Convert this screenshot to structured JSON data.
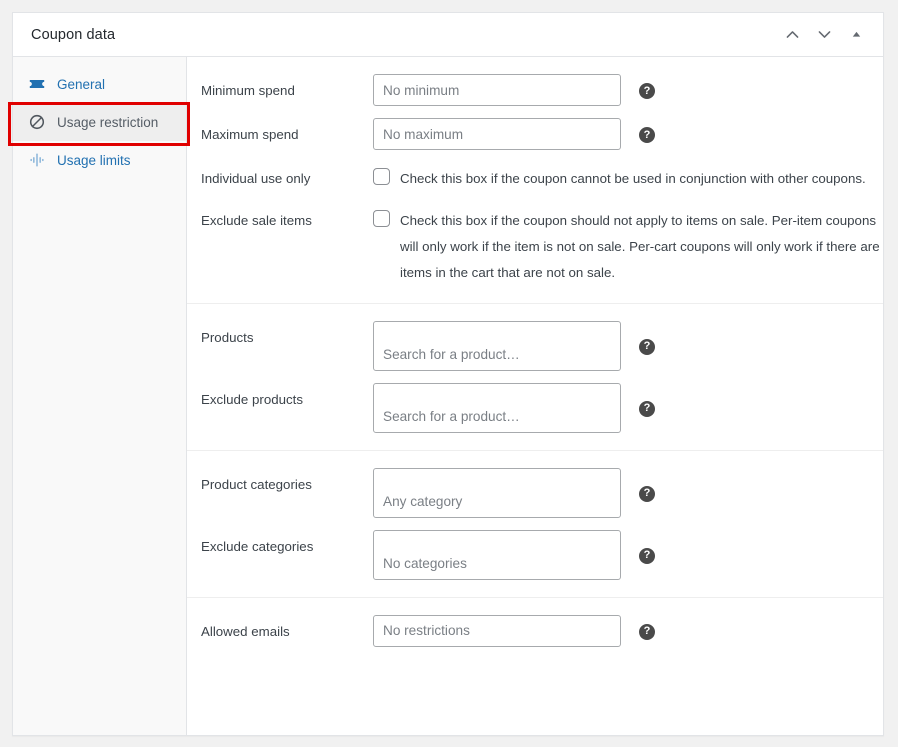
{
  "header": {
    "title": "Coupon data",
    "actions": [
      {
        "name": "move-up-button",
        "icon": "chevron-up-icon",
        "label": "Move up"
      },
      {
        "name": "move-down-button",
        "icon": "chevron-down-icon",
        "label": "Move down"
      },
      {
        "name": "toggle-panel-button",
        "icon": "triangle-up-icon",
        "label": "Toggle panel"
      }
    ]
  },
  "sidebar": {
    "items": [
      {
        "label": "General",
        "icon": "ticket-icon",
        "active": false
      },
      {
        "label": "Usage restriction",
        "icon": "no-entry-icon",
        "active": true
      },
      {
        "label": "Usage limits",
        "icon": "usage-limits-icon",
        "active": false
      }
    ],
    "annotation_color": "#e00000"
  },
  "main": {
    "groups": [
      {
        "rows": [
          {
            "type": "text",
            "label": "Minimum spend",
            "value": "",
            "placeholder": "No minimum",
            "help": "?"
          },
          {
            "type": "text",
            "label": "Maximum spend",
            "value": "",
            "placeholder": "No maximum",
            "help": "?"
          },
          {
            "type": "checkbox",
            "label": "Individual use only",
            "checked": false,
            "text": "Check this box if the coupon cannot be used in conjunction with other coupons."
          },
          {
            "type": "checkbox",
            "label": "Exclude sale items",
            "checked": false,
            "text": "Check this box if the coupon should not apply to items on sale. Per-item coupons will only work if the item is not on sale. Per-cart coupons will only work if there are items in the cart that are not on sale."
          }
        ]
      },
      {
        "rows": [
          {
            "type": "select",
            "label": "Products",
            "placeholder": "Search for a product…",
            "help": "?"
          },
          {
            "type": "select",
            "label": "Exclude products",
            "placeholder": "Search for a product…",
            "help": "?"
          }
        ]
      },
      {
        "rows": [
          {
            "type": "select",
            "label": "Product categories",
            "placeholder": "Any category",
            "help": "?"
          },
          {
            "type": "select",
            "label": "Exclude categories",
            "placeholder": "No categories",
            "help": "?"
          }
        ]
      },
      {
        "rows": [
          {
            "type": "text",
            "label": "Allowed emails",
            "value": "",
            "placeholder": "No restrictions",
            "help": "?"
          }
        ]
      }
    ]
  },
  "colors": {
    "link": "#2271b1",
    "panel_bg": "#ffffff",
    "page_bg": "#f1f1f1",
    "sidebar_bg": "#f9f9f9",
    "active_item_bg": "#eeeeee",
    "border": "#e2e4e7",
    "annotation": "#e00000"
  }
}
